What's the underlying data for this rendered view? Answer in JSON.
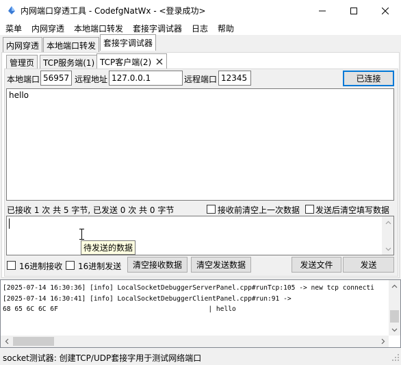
{
  "window": {
    "title": "内网端口穿透工具 - CodefgNatWx - <登录成功>",
    "minimize_icon": "minimize-icon",
    "maximize_icon": "maximize-icon",
    "close_icon": "close-icon"
  },
  "menubar": {
    "items": [
      "菜单",
      "内网穿透",
      "本地端口转发",
      "套接字调试器",
      "日志",
      "帮助"
    ]
  },
  "main_tabs": [
    "内网穿透",
    "本地端口转发",
    "套接字调试器"
  ],
  "main_tabs_active": "套接字调试器",
  "sub_tabs": [
    "管理页",
    "TCP服务端(1)",
    "TCP客户端(2)"
  ],
  "sub_tabs_active": "TCP客户端(2)",
  "connection": {
    "local_port_label": "本地端口",
    "local_port_value": "56957",
    "remote_addr_label": "远程地址",
    "remote_addr_value": "127.0.0.1",
    "remote_port_label": "远程端口",
    "remote_port_value": "12345",
    "connect_button": "已连接"
  },
  "receive": {
    "content": "hello",
    "stats": "已接收 1 次 共 5 字节, 已发送 0 次 共 0 字节",
    "clear_before_receive_label": "接收前清空上一次数据",
    "clear_after_send_label": "发送后清空填写数据"
  },
  "send": {
    "content": "",
    "tooltip": "待发送的数据",
    "hex_receive_label": "16进制接收",
    "hex_send_label": "16进制发送",
    "clear_receive_button": "清空接收数据",
    "clear_send_button": "清空发送数据",
    "send_file_button": "发送文件",
    "send_button": "发送"
  },
  "log": {
    "lines": [
      "[2025-07-14 16:30:36] [info] LocalSocketDebuggerServerPanel.cpp#runTcp:105 -> new tcp connecti",
      "[2025-07-14 16:30:41] [info] LocalSocketDebuggerClientPanel.cpp#run:91 ->",
      "68 65 6C 6C 6F                                      | hello"
    ]
  },
  "status": {
    "text": "socket测试器: 创建TCP/UDP套接字用于测试网络端口"
  },
  "colors": {
    "accent": "#0078d7",
    "tooltip_bg": "#ffffe1"
  }
}
